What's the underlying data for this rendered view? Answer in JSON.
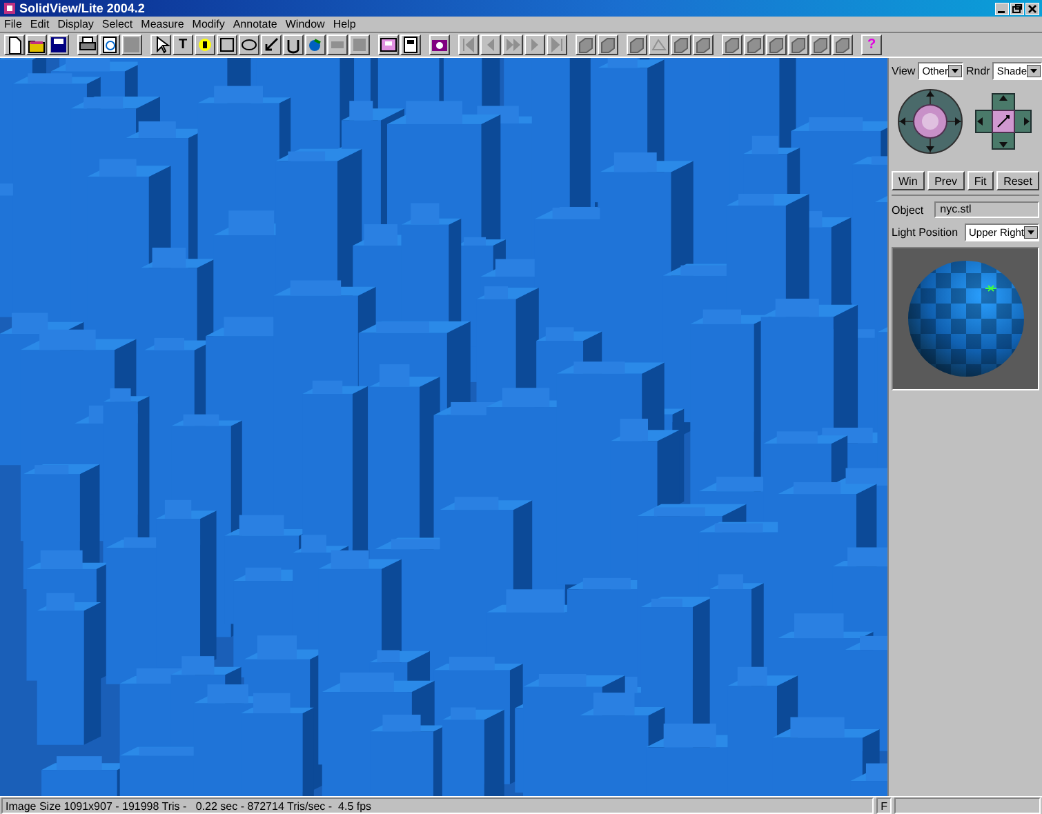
{
  "window": {
    "title": "SolidView/Lite 2004.2"
  },
  "menu": [
    "File",
    "Edit",
    "Display",
    "Select",
    "Measure",
    "Modify",
    "Annotate",
    "Window",
    "Help"
  ],
  "toolbar": {
    "text_tool": "T",
    "help": "?"
  },
  "side_panel": {
    "view": {
      "label": "View",
      "value": "Other"
    },
    "render": {
      "label": "Rndr",
      "value": "Shade"
    },
    "buttons": [
      "Win",
      "Prev",
      "Fit",
      "Reset"
    ],
    "object": {
      "label": "Object",
      "value": "nyc.stl"
    },
    "light_position": {
      "label": "Light Position",
      "value": "Upper Right"
    }
  },
  "status_bar": {
    "message": "Image Size 1091x907 - 191998 Tris -   0.22 sec - 872714 Tris/sec -  4.5 fps",
    "indicator": "F"
  }
}
